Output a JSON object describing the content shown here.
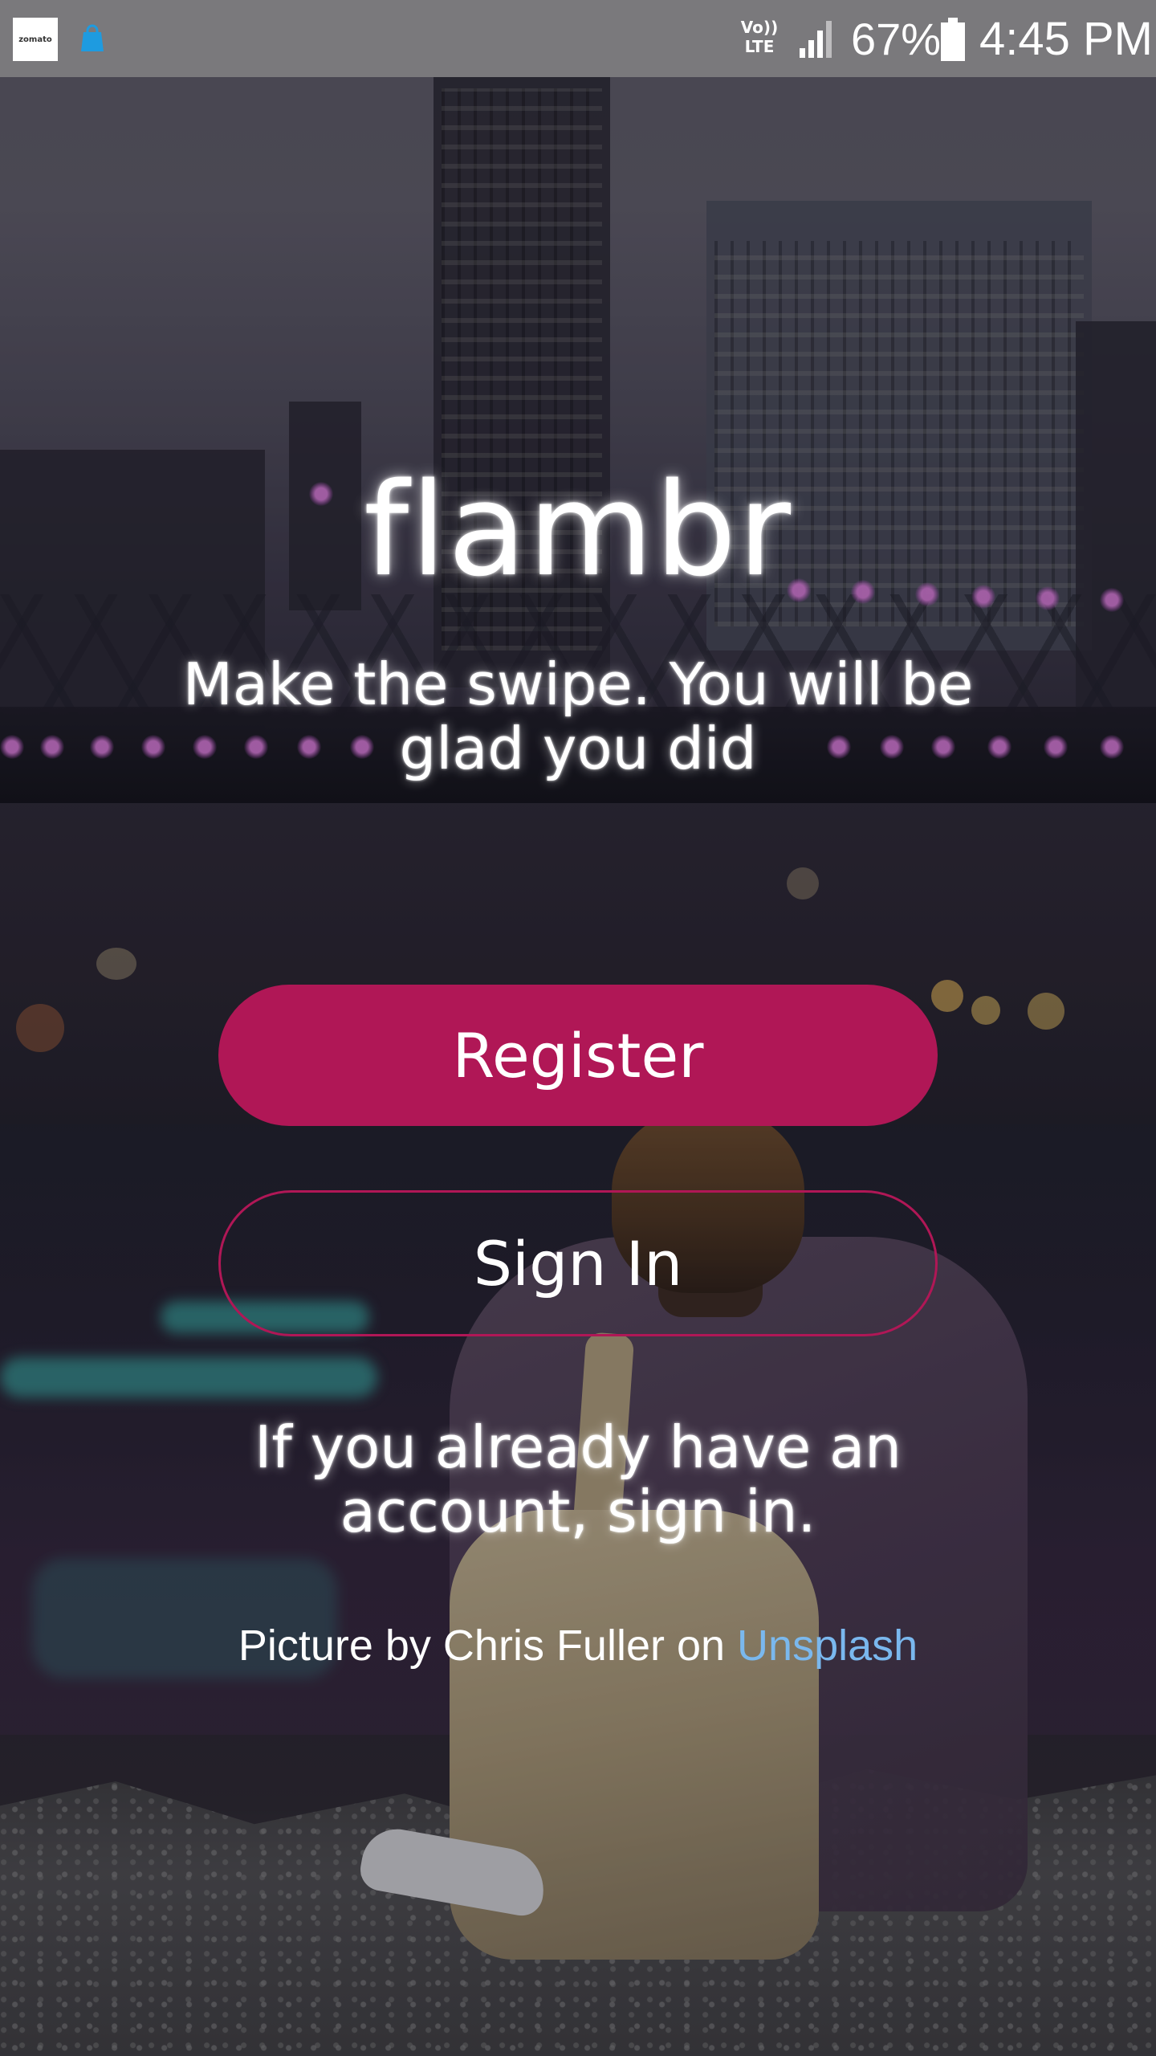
{
  "status_bar": {
    "app_icon_text": "zomato",
    "network": "Vo)) LTE",
    "battery_percent": "67%",
    "time": "4:45 PM"
  },
  "app": {
    "logo": "flambr",
    "tagline": "Make the swipe. You will be glad you did",
    "register_label": "Register",
    "signin_label": "Sign In",
    "signin_hint": "If you already have an account, sign in.",
    "credit_prefix": "Picture by Chris Fuller on ",
    "credit_link": "Unsplash"
  },
  "colors": {
    "accent": "#b01756",
    "link": "#7ab8ee",
    "text": "#ffffff",
    "status_bar": "#7a797c"
  },
  "icons": {
    "status_left": [
      "zomato-app-icon",
      "shopping-bag-icon"
    ],
    "status_right": [
      "volte-icon",
      "signal-icon",
      "battery-icon"
    ]
  }
}
